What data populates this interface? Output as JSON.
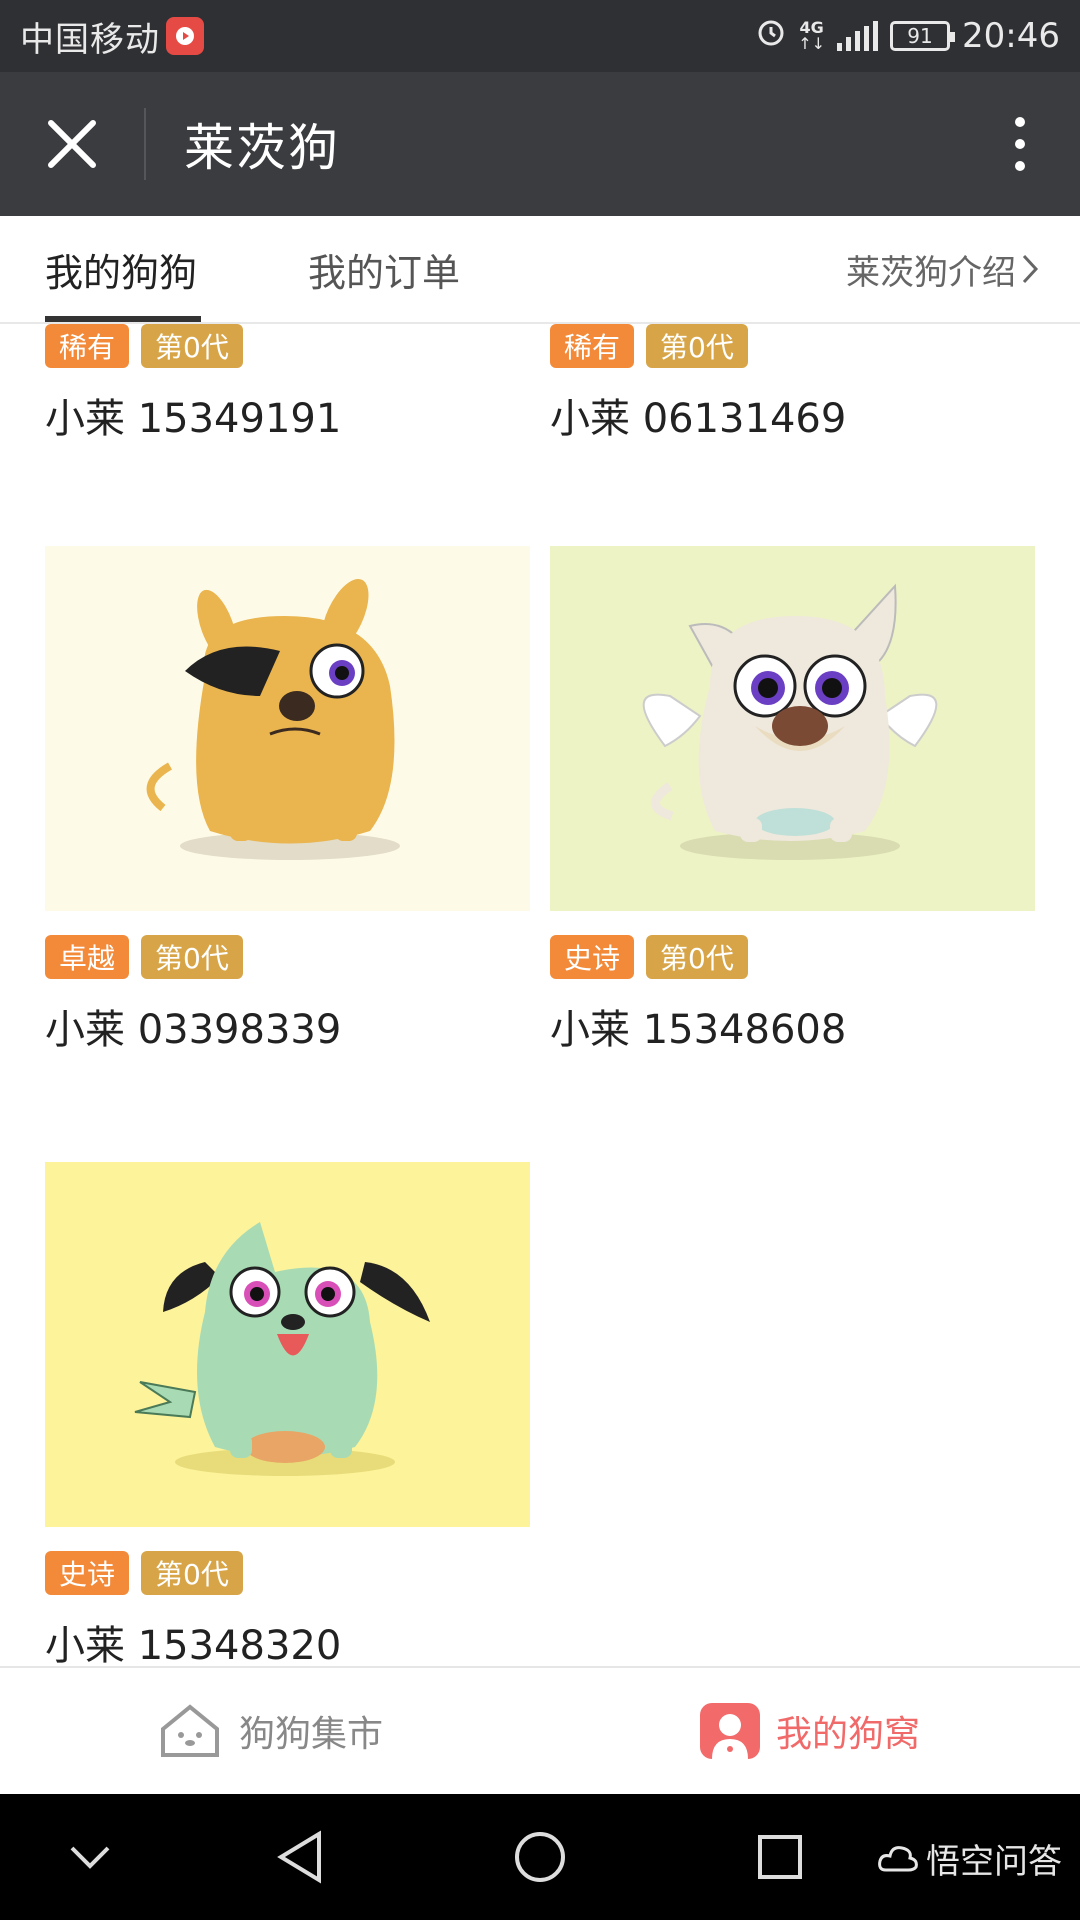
{
  "status_bar": {
    "carrier": "中国移动",
    "network": "4G",
    "battery": "91",
    "time": "20:46"
  },
  "title_bar": {
    "title": "莱茨狗"
  },
  "tabs": {
    "items": [
      {
        "label": "我的狗狗",
        "active": true
      },
      {
        "label": "我的订单",
        "active": false
      }
    ],
    "intro_link": "莱茨狗介绍"
  },
  "dogs": [
    {
      "rarity": "稀有",
      "generation": "第0代",
      "name": "小莱 15349191"
    },
    {
      "rarity": "稀有",
      "generation": "第0代",
      "name": "小莱 06131469"
    },
    {
      "rarity": "卓越",
      "generation": "第0代",
      "name": "小莱 03398339",
      "bg": "#fdfbe8",
      "body": "#eab44e"
    },
    {
      "rarity": "史诗",
      "generation": "第0代",
      "name": "小莱 15348608",
      "bg": "#eef3c6",
      "body": "#efe8dc"
    },
    {
      "rarity": "史诗",
      "generation": "第0代",
      "name": "小莱 15348320",
      "bg": "#fdf39a",
      "body": "#a8dbb4"
    }
  ],
  "bottom_nav": {
    "market": "狗狗集市",
    "mine": "我的狗窝"
  },
  "watermark": "悟空问答",
  "colors": {
    "tag_rarity": "#f28a3a",
    "tag_generation": "#d7a547",
    "accent": "#f06a6a"
  }
}
